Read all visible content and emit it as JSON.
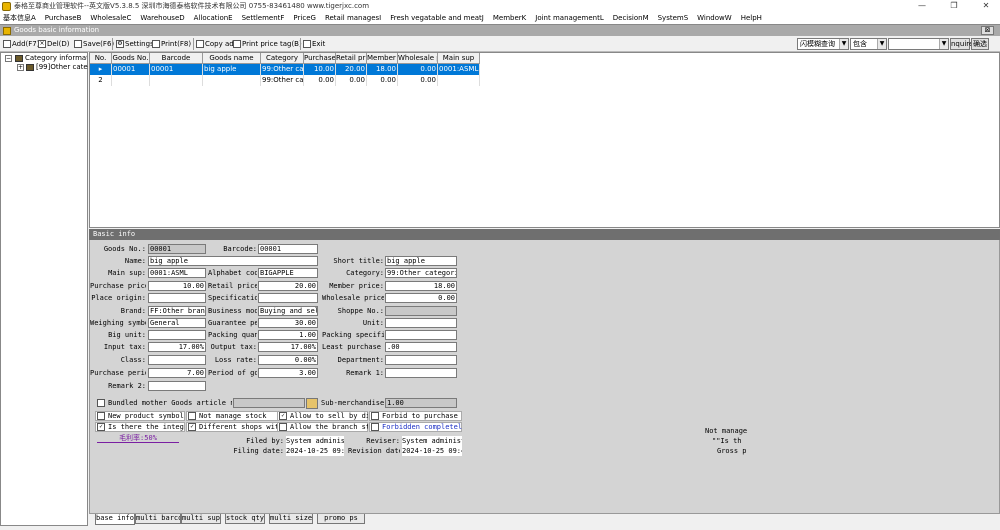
{
  "window": {
    "title": "泰格至尊商业管理软件--英文版V5.3.8.5  深圳市海德泰格软件技术有限公司  0755-83461480  www.tigerjxc.com",
    "minimize": "—",
    "restore": "❐",
    "close": "✕"
  },
  "menu": [
    "基本信息A",
    "PurchaseB",
    "WholesaleC",
    "WarehouseD",
    "AllocationE",
    "SettlementF",
    "PriceG",
    "Retail managesI",
    "Fresh vegatable and meatJ",
    "MemberK",
    "Joint managementL",
    "DecisionM",
    "SystemS",
    "WindowW",
    "HelpH"
  ],
  "child_window": {
    "title": "Goods basic information",
    "close": "⊠"
  },
  "toolbar": {
    "add": "Add(F7)",
    "del": "Del(D)",
    "save": "Save(F6)",
    "settings": "Settings",
    "print": "Print(F8)",
    "copy_add": "Copy add",
    "print_tag": "Print price tag(B)",
    "exit": "Exit",
    "search_mode": "闪模糊查询",
    "match_mode": "包含",
    "search_value": "",
    "inquire": "nquire",
    "confirm": "确选"
  },
  "tree": {
    "root": "Category information",
    "child": "[99]Other categories",
    "root_toggle": "−",
    "child_toggle": "+"
  },
  "grid": {
    "columns": [
      "No.",
      "Goods No.",
      "Barcode",
      "Goods name",
      "Category",
      "Purchase price",
      "Retail price",
      "Member price",
      "Wholesale price",
      "Main sup"
    ],
    "rows": [
      {
        "marker": "▸",
        "no": "1",
        "goods_no": "00001",
        "barcode": "00001",
        "name": "big apple",
        "category": "99:Other cate",
        "purchase": "10.00",
        "retail": "20.00",
        "member": "18.00",
        "wholesale": "0.00",
        "sup": "0001:ASML"
      },
      {
        "marker": "",
        "no": "2",
        "goods_no": "",
        "barcode": "",
        "name": "",
        "category": "99:Other cate",
        "purchase": "0.00",
        "retail": "0.00",
        "member": "0.00",
        "wholesale": "0.00",
        "sup": ""
      }
    ]
  },
  "info": {
    "header": "Basic info",
    "labels": {
      "goods_no": "Goods No.:",
      "barcode": "Barcode:",
      "name": "Name:",
      "short_title": "Short title:",
      "main_sup": "Main sup:",
      "alphabet": "Alphabet code:",
      "category": "Category:",
      "purchase_price": "Purchase price:",
      "retail_price": "Retail price:",
      "member_price": "Member price:",
      "place_origin": "Place origin:",
      "specification": "Specification:",
      "wholesale_price": "Wholesale price:",
      "brand": "Brand:",
      "business_mode": "Business mode:",
      "shoppe_no": "Shoppe No.:",
      "weighing_symbol": "Weighing symbol:",
      "guarantee_period": "Guarantee period:",
      "unit": "Unit:",
      "big_unit": "Big unit:",
      "packing_quantity": "Packing quantity:",
      "packing_spec": "Packing specification:",
      "input_tax": "Input tax:",
      "output_tax": "Output tax:",
      "least_purchase_qty": "Least purchase quantity:",
      "class": "Class:",
      "loss_rate": "Loss rate:",
      "department": "Department:",
      "purchase_period": "Purchase period:",
      "goods_period": "Period of goods period:",
      "remark1": "Remark 1:",
      "remark2": "Remark 2:",
      "filing_by": "Filed by:",
      "reviser": "Reviser:",
      "filing_date": "Filing date:",
      "revision_date": "Revision date:"
    },
    "values": {
      "goods_no": "00001",
      "barcode": "00001",
      "name": "big apple",
      "short_title": "big apple",
      "main_sup": "0001:ASML",
      "alphabet": "BIGAPPLE",
      "category": "99:Other categories",
      "purchase_price": "10.00",
      "retail_price": "20.00",
      "member_price": "18.00",
      "place_origin": "",
      "specification": "",
      "wholesale_price": "0.00",
      "brand": "FF:Other brand",
      "business_mode": "Buying and selling",
      "shoppe_no": "",
      "weighing_symbol": "General",
      "guarantee_period": "30.00",
      "unit": "",
      "big_unit": "",
      "packing_quantity": "1.00",
      "packing_spec": "",
      "input_tax": "17.00%",
      "output_tax": "17.00%",
      "least_purchase_qty": ".00",
      "class": "",
      "loss_rate": "0.00%",
      "department": "",
      "purchase_period": "7.00",
      "goods_period": "3.00",
      "remark1": "",
      "remark2": "",
      "filing_by": "System administrator",
      "reviser": "System administrator",
      "filing_date": "2024-10-25 09:44:28",
      "revision_date": "2024-10-25 09:44:28"
    },
    "bundled_label": "Bundled mother Goods article number",
    "bundled_value": "",
    "sub_merch_label": "Sub-merchandise quantity",
    "sub_merch_value": "1.00",
    "checks": {
      "new_product": "New product symbol",
      "not_manage_stock": "Not manage stock",
      "allow_discount": "Allow to sell by discount",
      "forbid_purchase": "Forbid to purchase",
      "integral": "Is there the integral?",
      "diff_shops": "Different shops with different prices",
      "allow_branch": "Allow the branch store to purchase",
      "forbidden": "Forbidden completely"
    },
    "check_states": {
      "new_product": false,
      "not_manage_stock": false,
      "allow_discount": true,
      "forbid_purchase": false,
      "integral": true,
      "diff_shops": true,
      "allow_branch": false,
      "forbidden": false
    },
    "profit_rate": "毛利率:50%",
    "side_notes": [
      "Not manage",
      "\"\"Is th",
      "Gross p"
    ]
  },
  "tabs": [
    "base info",
    "multi barcode",
    "multi sup",
    "stock qty",
    "multi size",
    "promo ps"
  ],
  "colors": {
    "selection": "#0078d7",
    "panel": "#d4d4d4",
    "profit": "#7a1fa2",
    "forbidden": "#1c2fc4"
  }
}
